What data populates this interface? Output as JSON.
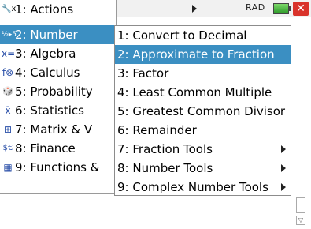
{
  "status": {
    "mode": "RAD",
    "close": "✕"
  },
  "main_menu": [
    {
      "icon": "🔧x",
      "label": "1: Actions"
    },
    {
      "icon": "½▸5",
      "label": "2: Number"
    },
    {
      "icon": "x=",
      "label": "3: Algebra"
    },
    {
      "icon": "f⊗",
      "label": "4: Calculus"
    },
    {
      "icon": "🎲",
      "label": "5: Probability"
    },
    {
      "icon": "x̄",
      "label": "6: Statistics"
    },
    {
      "icon": "⊞",
      "label": "7: Matrix & V"
    },
    {
      "icon": "$€",
      "label": "8: Finance"
    },
    {
      "icon": "▦",
      "label": "9: Functions &"
    }
  ],
  "sub_menu": [
    {
      "label": "1: Convert to Decimal"
    },
    {
      "label": "2: Approximate to Fraction"
    },
    {
      "label": "3: Factor"
    },
    {
      "label": "4: Least Common Multiple"
    },
    {
      "label": "5: Greatest Common Divisor"
    },
    {
      "label": "6: Remainder"
    },
    {
      "label": "7: Fraction Tools"
    },
    {
      "label": "8: Number Tools"
    },
    {
      "label": "9: Complex Number Tools"
    }
  ],
  "colors": {
    "selection": "#3b8fc2",
    "close": "#d9332b",
    "battery": "#2e9a2a"
  }
}
